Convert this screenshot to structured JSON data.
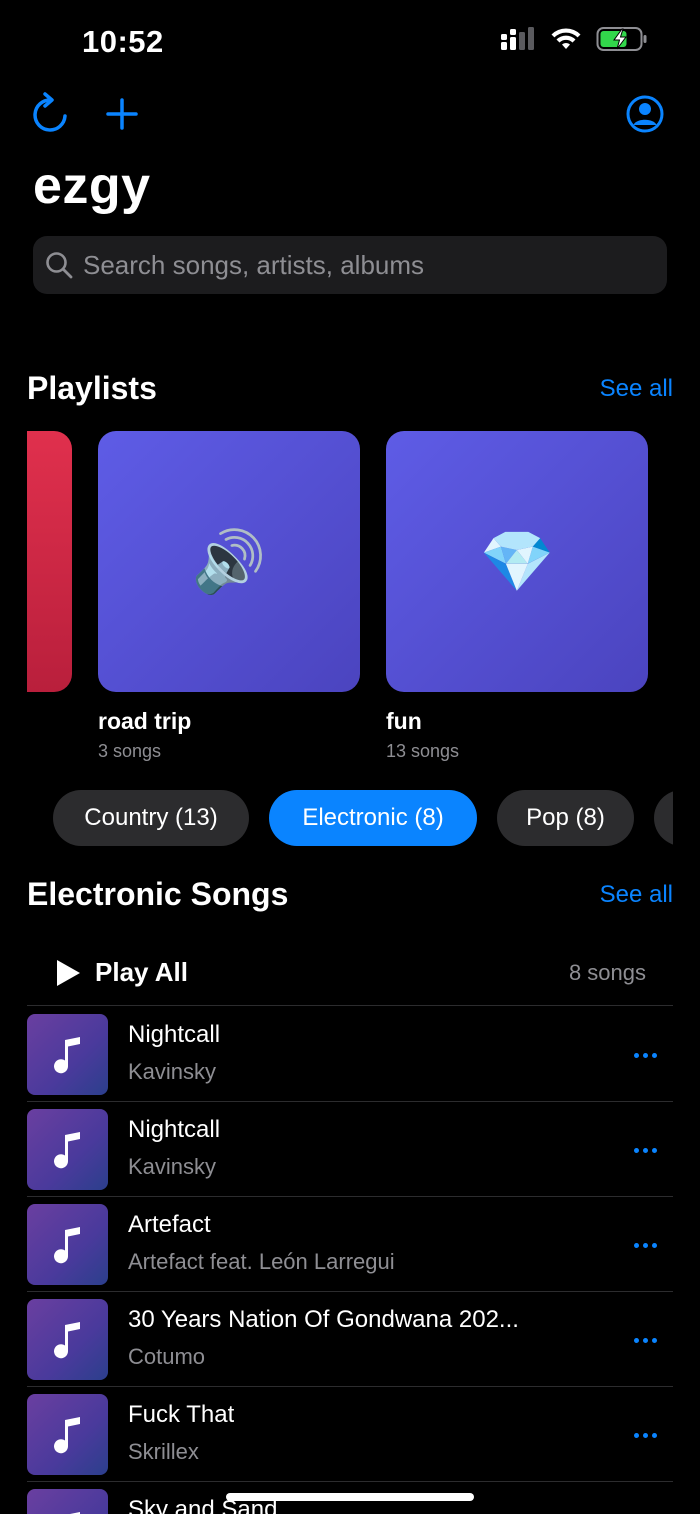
{
  "status_bar": {
    "time": "10:52"
  },
  "app": {
    "title": "ezgy"
  },
  "search": {
    "placeholder": "Search songs, artists, albums"
  },
  "playlists": {
    "title": "Playlists",
    "see_all": "See all",
    "items": [
      {
        "name": "road trip",
        "count": "3 songs",
        "emoji": "🔊"
      },
      {
        "name": "fun",
        "count": "13 songs",
        "emoji": "💎"
      }
    ]
  },
  "genres": [
    {
      "label": "Country (13)",
      "active": false
    },
    {
      "label": "Electronic (8)",
      "active": true
    },
    {
      "label": "Pop (8)",
      "active": false
    }
  ],
  "songs_section": {
    "title": "Electronic Songs",
    "see_all": "See all",
    "play_all": "Play All",
    "count": "8 songs",
    "items": [
      {
        "title": "Nightcall",
        "artist": "Kavinsky"
      },
      {
        "title": "Nightcall",
        "artist": "Kavinsky"
      },
      {
        "title": "Artefact",
        "artist": "Artefact feat. León Larregui"
      },
      {
        "title": "30 Years Nation Of Gondwana 202...",
        "artist": "Cotumo"
      },
      {
        "title": "Fuck That",
        "artist": "Skrillex"
      },
      {
        "title": "Sky and Sand",
        "artist": ""
      }
    ]
  },
  "colors": {
    "accent": "#0a84ff",
    "background": "#000000",
    "chip": "#2c2c2e",
    "playlist_art": "#5e5ce6"
  }
}
